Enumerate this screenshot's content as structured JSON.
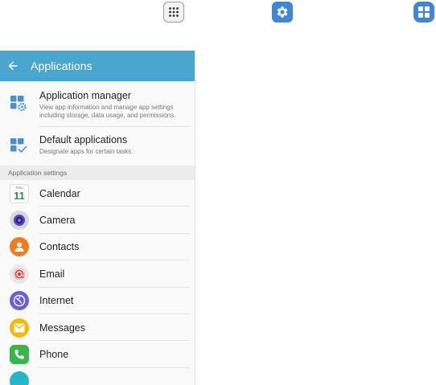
{
  "toolbar_icons": [
    {
      "name": "apps-icon",
      "color": "#f3f3f3"
    },
    {
      "name": "settings-icon",
      "color": "#3f86d8"
    },
    {
      "name": "applications-icon",
      "color": "#3f86d8"
    }
  ],
  "header": {
    "title": "Applications",
    "color": "#49a6cf"
  },
  "menu": [
    {
      "title": "Application manager",
      "subtitle": "View app information and manage app settings including storage, data usage, and permissions.",
      "icon": "app-manager-icon"
    },
    {
      "title": "Default applications",
      "subtitle": "Designate apps for certain tasks.",
      "icon": "default-apps-icon"
    }
  ],
  "section_header": "Application settings",
  "apps": [
    {
      "label": "Calendar",
      "icon": "calendar-icon",
      "day": "THU",
      "date": "11"
    },
    {
      "label": "Camera",
      "icon": "camera-icon",
      "color": "#d8d8d8"
    },
    {
      "label": "Contacts",
      "icon": "contacts-icon",
      "color": "#f07c1e"
    },
    {
      "label": "Email",
      "icon": "email-icon",
      "color": "#e9e9e9"
    },
    {
      "label": "Internet",
      "icon": "internet-icon",
      "color": "#6a5fd6"
    },
    {
      "label": "Messages",
      "icon": "messages-icon",
      "color": "#f5b800"
    },
    {
      "label": "Phone",
      "icon": "phone-icon",
      "color": "#3ab54a"
    },
    {
      "label": "",
      "icon": "partial-app-icon",
      "color": "#25b7c9"
    }
  ]
}
